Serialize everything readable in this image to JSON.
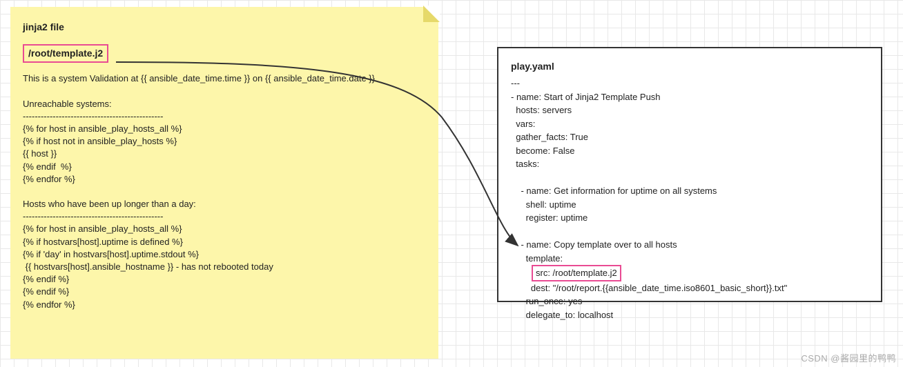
{
  "left_note": {
    "title": "jinja2 file",
    "filepath": "/root/template.j2",
    "body": "This is a system Validation at {{ ansible_date_time.time }} on {{ ansible_date_time.date }}\n\nUnreachable systems:\n-----------------------------------------------\n{% for host in ansible_play_hosts_all %}\n{% if host not in ansible_play_hosts %}\n{{ host }}\n{% endif  %}\n{% endfor %}\n\nHosts who have been up longer than a day:\n-----------------------------------------------\n{% for host in ansible_play_hosts_all %}\n{% if hostvars[host].uptime is defined %}\n{% if 'day' in hostvars[host].uptime.stdout %}\n {{ hostvars[host].ansible_hostname }} - has not rebooted today\n{% endif %}\n{% endif %}\n{% endfor %}"
  },
  "right_panel": {
    "title": "play.yaml",
    "pre": "---\n- name: Start of Jinja2 Template Push\n  hosts: servers\n  vars:\n  gather_facts: True\n  become: False\n  tasks:\n\n    - name: Get information for uptime on all systems\n      shell: uptime\n      register: uptime\n\n    - name: Copy template over to all hosts\n      template:",
    "src_label": "src: /root/template.j2",
    "post": "        dest: \"/root/report.{{ansible_date_time.iso8601_basic_short}}.txt\"\n      run_once: yes\n      delegate_to: localhost"
  },
  "watermark": "CSDN @酱园里的鸭鸭"
}
